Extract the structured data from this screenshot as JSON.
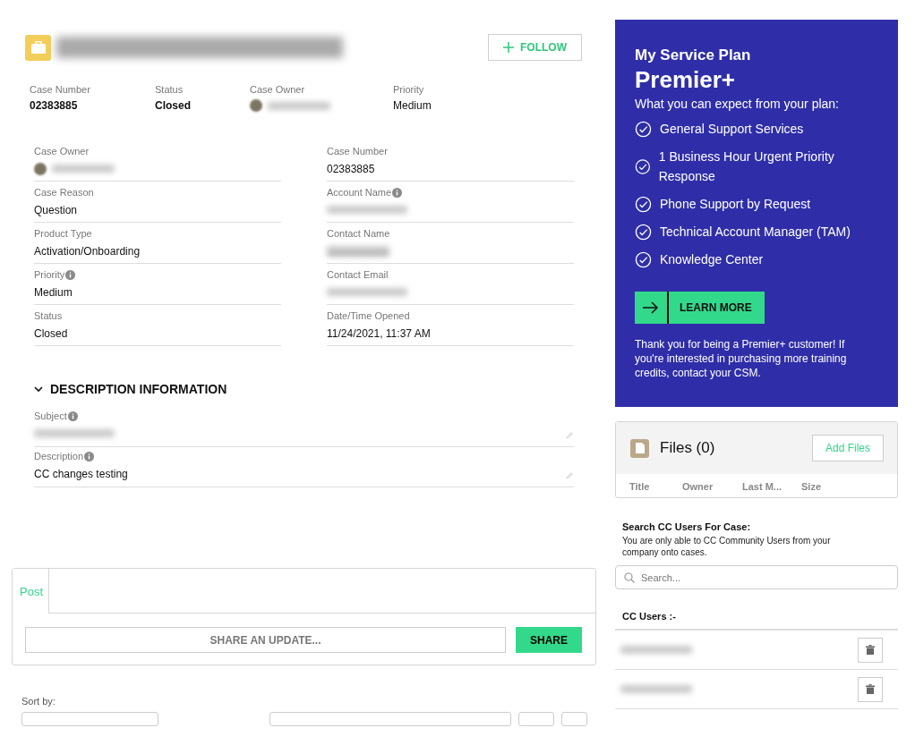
{
  "header": {
    "follow_button": "FOLLOW"
  },
  "highlights": [
    {
      "label": "Case Number",
      "value": "02383885",
      "kind": "bold"
    },
    {
      "label": "Status",
      "value": "Closed",
      "kind": "bold"
    },
    {
      "label": "Case Owner",
      "kind": "user-redacted"
    },
    {
      "label": "Priority",
      "value": "Medium",
      "kind": "plain"
    }
  ],
  "details": {
    "left": [
      {
        "label": "Case Owner",
        "kind": "user-redacted",
        "info": false
      },
      {
        "label": "Case Reason",
        "value": "Question",
        "kind": "text",
        "info": false
      },
      {
        "label": "Product Type",
        "value": "Activation/Onboarding",
        "kind": "text",
        "info": false
      },
      {
        "label": "Priority",
        "value": "Medium",
        "kind": "text",
        "info": true
      },
      {
        "label": "Status",
        "value": "Closed",
        "kind": "text",
        "info": false
      }
    ],
    "right": [
      {
        "label": "Case Number",
        "value": "02383885",
        "kind": "text",
        "info": false
      },
      {
        "label": "Account Name",
        "kind": "redacted",
        "info": true
      },
      {
        "label": "Contact Name",
        "kind": "link-redacted",
        "info": false
      },
      {
        "label": "Contact Email",
        "kind": "redacted",
        "info": false
      },
      {
        "label": "Date/Time Opened",
        "value": "11/24/2021, 11:37 AM",
        "kind": "text",
        "info": false
      }
    ]
  },
  "description_section": {
    "title": "DESCRIPTION INFORMATION",
    "expanded": true,
    "fields": [
      {
        "label": "Subject",
        "kind": "redacted",
        "info": true
      },
      {
        "label": "Description",
        "value": "CC changes testing",
        "kind": "text",
        "info": true
      }
    ]
  },
  "publisher": {
    "tabs": [
      {
        "label": "Post",
        "selected": true
      }
    ],
    "placeholder": "SHARE AN UPDATE...",
    "share_button": "SHARE"
  },
  "feed": {
    "sort_label": "Sort by:"
  },
  "service_plan": {
    "heading": "My Service Plan",
    "plan": "Premier+",
    "intro": "What you can expect from your plan:",
    "features": [
      "General Support Services",
      "1 Business Hour Urgent Priority Response",
      "Phone Support by Request",
      "Technical Account Manager (TAM)",
      "Knowledge Center"
    ],
    "button": "LEARN MORE",
    "footer": "Thank you for being a Premier+ customer! If you're interested in purchasing more training credits, contact your CSM."
  },
  "files": {
    "title": "Files (0)",
    "add_button": "Add Files",
    "columns": [
      "Title",
      "Owner",
      "Last M...",
      "Size"
    ]
  },
  "cc_search": {
    "title": "Search CC Users For Case:",
    "note": "You are only able to CC Community Users from your company onto cases.",
    "placeholder": "Search..."
  },
  "cc_users": {
    "title": "CC Users :-",
    "rows": [
      {
        "kind": "redacted"
      },
      {
        "kind": "redacted"
      }
    ]
  }
}
